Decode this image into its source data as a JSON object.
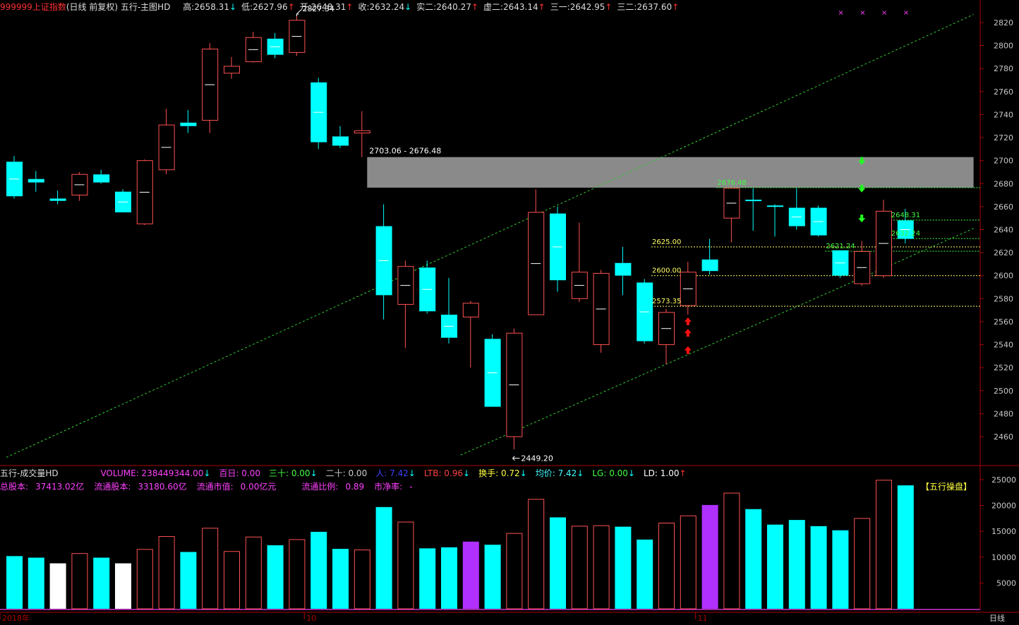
{
  "header": {
    "code": "999999",
    "name": "上证指数",
    "mode": "(日线 前复权)",
    "indicator": "五行-主图HD",
    "stats": [
      {
        "label": "高:",
        "value": "2658.31",
        "dir": "down"
      },
      {
        "label": "低:",
        "value": "2627.96",
        "dir": "up"
      },
      {
        "label": "开:",
        "value": "2648.31",
        "dir": "up"
      },
      {
        "label": "收:",
        "value": "2632.24",
        "dir": "down"
      },
      {
        "label": "实二:",
        "value": "2640.27",
        "dir": "up"
      },
      {
        "label": "虚二:",
        "value": "2643.14",
        "dir": "up"
      },
      {
        "label": "三一:",
        "value": "2642.95",
        "dir": "up"
      },
      {
        "label": "三二:",
        "value": "2637.60",
        "dir": "up"
      }
    ]
  },
  "volume_header": {
    "name": "五行-成交量HD",
    "items": [
      {
        "label": "VOLUME: ",
        "value": "238449344.00",
        "dir": "down",
        "color": "#ff40ff"
      },
      {
        "label": "百日: ",
        "value": "0.00",
        "dir": "",
        "color": "#ff40ff"
      },
      {
        "label": "三十: ",
        "value": "0.00",
        "dir": "down",
        "color": "#40ff40"
      },
      {
        "label": "二十: ",
        "value": "0.00",
        "dir": "",
        "color": "#cccccc"
      },
      {
        "label": "人: ",
        "value": "7.42",
        "dir": "down",
        "color": "#4040ff"
      },
      {
        "label": "LTB: ",
        "value": "0.96",
        "dir": "down",
        "color": "#ff4040"
      },
      {
        "label": "换手: ",
        "value": "0.72",
        "dir": "down",
        "color": "#ffff40"
      },
      {
        "label": "均价: ",
        "value": "7.42",
        "dir": "down",
        "color": "#40ffff"
      },
      {
        "label": "LG: ",
        "value": "0.00",
        "dir": "down",
        "color": "#40ff40"
      },
      {
        "label": "LD: ",
        "value": "1.00",
        "dir": "up",
        "color": "#ffffff"
      }
    ],
    "info": [
      {
        "label": "总股本:",
        "value": "37413.02亿"
      },
      {
        "label": "流通股本:",
        "value": "33180.60亿"
      },
      {
        "label": "流通市值:",
        "value": "0.00亿元"
      },
      {
        "label": "流通比例:",
        "value": "0.89"
      },
      {
        "label": "市净率:",
        "value": "-"
      }
    ],
    "badge": "【五行操盘】"
  },
  "colors": {
    "up": "#ff5050",
    "down": "#00ffff",
    "axis": "#b00000",
    "channel": "#33cc33",
    "level": "#ffff66",
    "zone": "#8a8a8a",
    "grid_text": "#c8c8c8",
    "purple": "#b030ff"
  },
  "chart_data": {
    "type": "candlestick",
    "ylim": [
      2440,
      2830
    ],
    "yticks": [
      2460,
      2480,
      2500,
      2520,
      2540,
      2560,
      2580,
      2600,
      2620,
      2640,
      2660,
      2680,
      2700,
      2720,
      2740,
      2760,
      2780,
      2800,
      2820
    ],
    "x_labels": [
      {
        "index": 0,
        "text": "2018年"
      },
      {
        "index": 14,
        "text": "10"
      },
      {
        "index": 32,
        "text": "11"
      }
    ],
    "candles": [
      {
        "o": 2699,
        "h": 2704,
        "l": 2667,
        "c": 2669
      },
      {
        "o": 2684,
        "h": 2691,
        "l": 2673,
        "c": 2681
      },
      {
        "o": 2667,
        "h": 2674,
        "l": 2662,
        "c": 2665
      },
      {
        "o": 2670,
        "h": 2690,
        "l": 2665,
        "c": 2688
      },
      {
        "o": 2688,
        "h": 2692,
        "l": 2680,
        "c": 2681
      },
      {
        "o": 2673,
        "h": 2675,
        "l": 2663,
        "c": 2655
      },
      {
        "o": 2645,
        "h": 2701,
        "l": 2644,
        "c": 2700
      },
      {
        "o": 2692,
        "h": 2745,
        "l": 2688,
        "c": 2731
      },
      {
        "o": 2733,
        "h": 2744,
        "l": 2724,
        "c": 2730
      },
      {
        "o": 2735,
        "h": 2802,
        "l": 2724,
        "c": 2797
      },
      {
        "o": 2776,
        "h": 2790,
        "l": 2771,
        "c": 2782
      },
      {
        "o": 2786,
        "h": 2812,
        "l": 2785,
        "c": 2807
      },
      {
        "o": 2806,
        "h": 2811,
        "l": 2789,
        "c": 2792
      },
      {
        "o": 2794,
        "h": 2827,
        "l": 2791,
        "c": 2822
      },
      {
        "o": 2768,
        "h": 2772,
        "l": 2710,
        "c": 2716
      },
      {
        "o": 2721,
        "h": 2730,
        "l": 2711,
        "c": 2713
      },
      {
        "o": 2724,
        "h": 2743,
        "l": 2703,
        "c": 2726
      },
      {
        "o": 2643,
        "h": 2662,
        "l": 2562,
        "c": 2583
      },
      {
        "o": 2575,
        "h": 2613,
        "l": 2537,
        "c": 2608
      },
      {
        "o": 2607,
        "h": 2613,
        "l": 2567,
        "c": 2569
      },
      {
        "o": 2566,
        "h": 2598,
        "l": 2541,
        "c": 2546
      },
      {
        "o": 2564,
        "h": 2578,
        "l": 2520,
        "c": 2576
      },
      {
        "o": 2545,
        "h": 2549,
        "l": 2487,
        "c": 2486
      },
      {
        "o": 2460,
        "h": 2554,
        "l": 2449,
        "c": 2550
      },
      {
        "o": 2566,
        "h": 2675,
        "l": 2566,
        "c": 2655
      },
      {
        "o": 2654,
        "h": 2660,
        "l": 2586,
        "c": 2596
      },
      {
        "o": 2580,
        "h": 2646,
        "l": 2577,
        "c": 2603
      },
      {
        "o": 2540,
        "h": 2605,
        "l": 2533,
        "c": 2602
      },
      {
        "o": 2611,
        "h": 2625,
        "l": 2583,
        "c": 2600
      },
      {
        "o": 2594,
        "h": 2597,
        "l": 2541,
        "c": 2543
      },
      {
        "o": 2540,
        "h": 2571,
        "l": 2523,
        "c": 2568
      },
      {
        "o": 2574,
        "h": 2612,
        "l": 2566,
        "c": 2603
      },
      {
        "o": 2614,
        "h": 2632,
        "l": 2601,
        "c": 2604
      },
      {
        "o": 2650,
        "h": 2676,
        "l": 2629,
        "c": 2676
      },
      {
        "o": 2666,
        "h": 2676,
        "l": 2639,
        "c": 2665
      },
      {
        "o": 2661,
        "h": 2662,
        "l": 2634,
        "c": 2660
      },
      {
        "o": 2659,
        "h": 2676,
        "l": 2640,
        "c": 2643
      },
      {
        "o": 2659,
        "h": 2661,
        "l": 2634,
        "c": 2635
      },
      {
        "o": 2622,
        "h": 2622,
        "l": 2598,
        "c": 2600
      },
      {
        "o": 2593,
        "h": 2630,
        "l": 2591,
        "c": 2621
      },
      {
        "o": 2600,
        "h": 2666,
        "l": 2598,
        "c": 2656
      },
      {
        "o": 2648,
        "h": 2658,
        "l": 2628,
        "c": 2632
      }
    ],
    "annotations": [
      {
        "index": 13,
        "price": 2827.34,
        "text": "2827.34",
        "dir": "up"
      },
      {
        "index": 23,
        "price": 2449.2,
        "text": "2449.20",
        "dir": "down"
      }
    ],
    "zone": {
      "from_index": 16.6,
      "to_index": 44.5,
      "top": 2703.06,
      "bottom": 2676.48,
      "label": "2703.06 - 2676.48"
    },
    "levels": [
      {
        "price": 2676.48,
        "from_index": 33,
        "text": "2676.48",
        "color": "green"
      },
      {
        "price": 2648.31,
        "from_index": 41,
        "text": "2648.31",
        "color": "green"
      },
      {
        "price": 2632.24,
        "from_index": 41,
        "text": "2632.24",
        "color": "green"
      },
      {
        "price": 2621.24,
        "from_index": 38,
        "text": "2621.24",
        "color": "green"
      },
      {
        "price": 2625.0,
        "from_index": 30,
        "text": "2625.00",
        "color": "yellow"
      },
      {
        "price": 2600.0,
        "from_index": 30,
        "text": "2600.00",
        "color": "yellow"
      },
      {
        "price": 2573.35,
        "from_index": 30,
        "text": "2573.35",
        "color": "yellow"
      }
    ],
    "channel": [
      {
        "from": [
          0,
          2442
        ],
        "to": [
          44.5,
          2827
        ]
      },
      {
        "from": [
          20.9,
          2444
        ],
        "to": [
          44.5,
          2641
        ]
      }
    ],
    "up_arrows": [
      {
        "index": 31,
        "price": 2560
      },
      {
        "index": 31,
        "price": 2550
      },
      {
        "index": 31,
        "price": 2535
      }
    ],
    "down_arrows": [
      {
        "index": 39,
        "price": 2700
      },
      {
        "index": 39,
        "price": 2676
      },
      {
        "index": 39,
        "price": 2650
      }
    ],
    "top_markers": [
      38,
      39,
      40,
      41
    ],
    "volume": {
      "ylim": [
        0,
        27000
      ],
      "yticks": [
        5000,
        10000,
        15000,
        20000,
        25000
      ],
      "values": [
        10200,
        9900,
        8800,
        10700,
        9900,
        8800,
        11500,
        14000,
        11000,
        15600,
        11100,
        13900,
        12300,
        13400,
        14900,
        11600,
        11400,
        19700,
        16800,
        11700,
        11900,
        13000,
        12400,
        14600,
        21200,
        17700,
        16000,
        16100,
        15900,
        13400,
        16600,
        18000,
        20100,
        22400,
        19300,
        16300,
        17200,
        16000,
        15200,
        17500,
        24900,
        23900
      ],
      "special": {
        "2": "white",
        "5": "white",
        "21": "purple",
        "32": "purple"
      }
    }
  }
}
